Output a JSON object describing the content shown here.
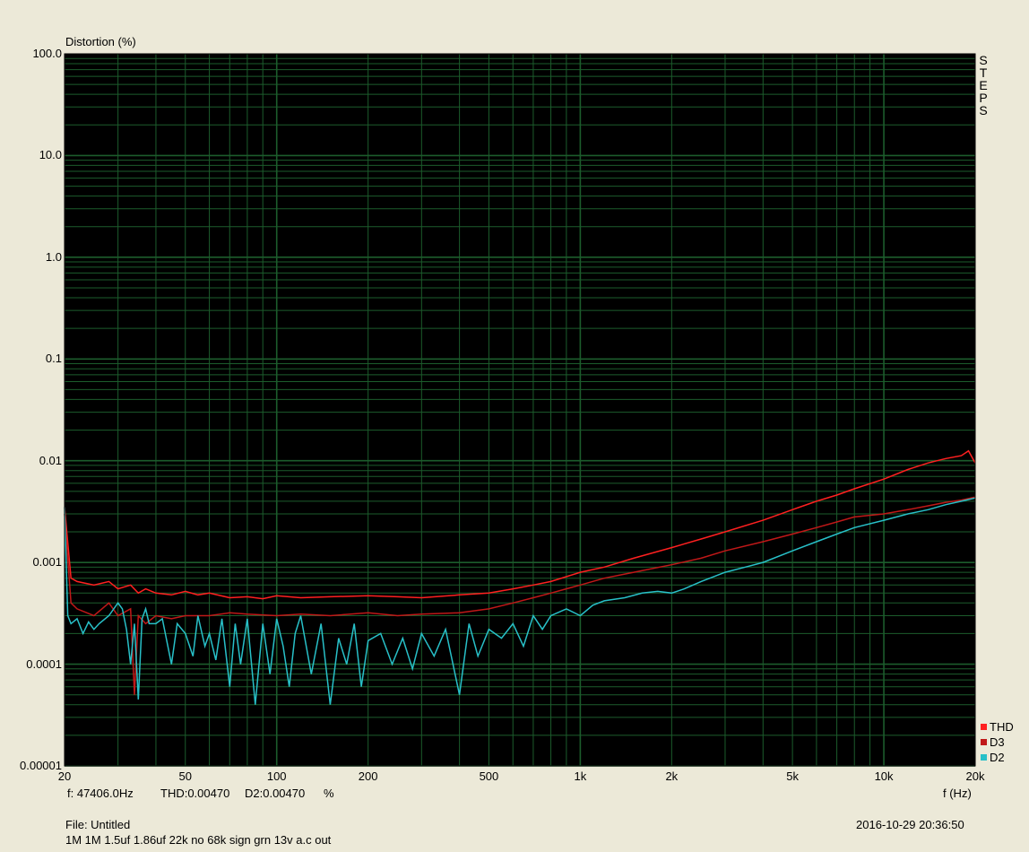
{
  "header": {
    "y_title": "Distortion (%)",
    "x_title": "f (Hz)",
    "steps_label": [
      "S",
      "T",
      "E",
      "P",
      "S"
    ]
  },
  "status": {
    "cursor_freq": "f: 47406.0Hz",
    "thd": "THD:0.00470",
    "d2": "D2:0.00470",
    "unit": "%"
  },
  "footer": {
    "file": "File: Untitled",
    "description": "1M 1M 1.5uf 1.86uf 22k no 68k sign grn 13v a.c out",
    "timestamp": "2016-10-29 20:36:50"
  },
  "colors": {
    "background": "#ece9d8",
    "plot_bg": "#000000",
    "grid": "#1c5c2c",
    "thd": "#ff2020",
    "d3": "#c01818",
    "d2": "#28c0c8"
  },
  "chart_data": {
    "type": "line",
    "x_scale": "log",
    "y_scale": "log",
    "xlim": [
      20,
      20000
    ],
    "ylim": [
      1e-05,
      100
    ],
    "x_ticks": [
      {
        "v": 20,
        "label": "20"
      },
      {
        "v": 50,
        "label": "50"
      },
      {
        "v": 100,
        "label": "100"
      },
      {
        "v": 200,
        "label": "200"
      },
      {
        "v": 500,
        "label": "500"
      },
      {
        "v": 1000,
        "label": "1k"
      },
      {
        "v": 2000,
        "label": "2k"
      },
      {
        "v": 5000,
        "label": "5k"
      },
      {
        "v": 10000,
        "label": "10k"
      },
      {
        "v": 20000,
        "label": "20k"
      }
    ],
    "y_ticks": [
      {
        "v": 100,
        "label": "100.0"
      },
      {
        "v": 10,
        "label": "10.0"
      },
      {
        "v": 1,
        "label": "1.0"
      },
      {
        "v": 0.1,
        "label": "0.1"
      },
      {
        "v": 0.01,
        "label": "0.01"
      },
      {
        "v": 0.001,
        "label": "0.001"
      },
      {
        "v": 0.0001,
        "label": "0.0001"
      },
      {
        "v": 1e-05,
        "label": "0.00001"
      }
    ],
    "legend_position": "bottom-right",
    "series": [
      {
        "name": "THD",
        "color": "#ff2020",
        "x": [
          20,
          21,
          22,
          25,
          28,
          30,
          33,
          35,
          37,
          40,
          45,
          50,
          55,
          60,
          70,
          80,
          90,
          100,
          120,
          150,
          200,
          250,
          300,
          400,
          500,
          600,
          700,
          800,
          1000,
          1200,
          1500,
          2000,
          2500,
          3000,
          4000,
          5000,
          6000,
          7000,
          8000,
          10000,
          12000,
          14000,
          16000,
          18000,
          19000,
          20000
        ],
        "y": [
          0.0035,
          0.0007,
          0.00065,
          0.0006,
          0.00065,
          0.00055,
          0.0006,
          0.0005,
          0.00055,
          0.0005,
          0.00048,
          0.00052,
          0.00048,
          0.0005,
          0.00045,
          0.00046,
          0.00044,
          0.00047,
          0.00045,
          0.00046,
          0.00047,
          0.00046,
          0.00045,
          0.00048,
          0.0005,
          0.00055,
          0.0006,
          0.00065,
          0.0008,
          0.0009,
          0.0011,
          0.0014,
          0.0017,
          0.002,
          0.0026,
          0.0033,
          0.004,
          0.0046,
          0.0053,
          0.0066,
          0.0082,
          0.0095,
          0.0105,
          0.0112,
          0.0125,
          0.0095
        ]
      },
      {
        "name": "D3",
        "color": "#c01818",
        "x": [
          20,
          21,
          22,
          25,
          28,
          30,
          33,
          34,
          35,
          37,
          40,
          45,
          50,
          60,
          70,
          80,
          100,
          120,
          150,
          200,
          250,
          300,
          400,
          500,
          600,
          700,
          800,
          1000,
          1200,
          1500,
          2000,
          2500,
          3000,
          4000,
          5000,
          6000,
          7000,
          8000,
          10000,
          12000,
          14000,
          16000,
          18000,
          20000
        ],
        "y": [
          0.003,
          0.0004,
          0.00035,
          0.0003,
          0.0004,
          0.0003,
          0.00035,
          5e-05,
          0.0003,
          0.00025,
          0.0003,
          0.00028,
          0.0003,
          0.0003,
          0.00032,
          0.00031,
          0.0003,
          0.00031,
          0.0003,
          0.00032,
          0.0003,
          0.00031,
          0.00032,
          0.00035,
          0.0004,
          0.00045,
          0.0005,
          0.0006,
          0.0007,
          0.0008,
          0.00095,
          0.0011,
          0.0013,
          0.0016,
          0.0019,
          0.0022,
          0.0025,
          0.0028,
          0.003,
          0.0033,
          0.0036,
          0.0039,
          0.0041,
          0.0044
        ]
      },
      {
        "name": "D2",
        "color": "#28c0c8",
        "x": [
          20,
          20.5,
          21,
          22,
          23,
          24,
          25,
          26,
          28,
          30,
          31,
          32,
          33,
          34,
          35,
          36,
          37,
          38,
          40,
          42,
          45,
          47,
          50,
          53,
          55,
          58,
          60,
          63,
          66,
          70,
          73,
          76,
          80,
          85,
          90,
          95,
          100,
          105,
          110,
          115,
          120,
          130,
          140,
          150,
          160,
          170,
          180,
          190,
          200,
          220,
          240,
          260,
          280,
          300,
          330,
          360,
          400,
          430,
          460,
          500,
          550,
          600,
          650,
          700,
          750,
          800,
          900,
          1000,
          1100,
          1200,
          1400,
          1600,
          1800,
          2000,
          2200,
          2500,
          3000,
          3500,
          4000,
          5000,
          6000,
          7000,
          8000,
          10000,
          12000,
          14000,
          16000,
          18000,
          20000
        ],
        "y": [
          0.0035,
          0.0003,
          0.00025,
          0.00028,
          0.0002,
          0.00026,
          0.00022,
          0.00025,
          0.0003,
          0.0004,
          0.00035,
          0.00022,
          0.0001,
          0.00025,
          4.5e-05,
          0.00028,
          0.00035,
          0.00025,
          0.00025,
          0.00028,
          0.0001,
          0.00025,
          0.0002,
          0.00012,
          0.0003,
          0.00015,
          0.0002,
          0.00011,
          0.00028,
          6e-05,
          0.00025,
          0.0001,
          0.00028,
          4e-05,
          0.00025,
          8e-05,
          0.00028,
          0.00015,
          6e-05,
          0.0002,
          0.0003,
          8e-05,
          0.00025,
          4e-05,
          0.00018,
          0.0001,
          0.00025,
          6e-05,
          0.00017,
          0.0002,
          0.0001,
          0.00018,
          9e-05,
          0.0002,
          0.00012,
          0.00022,
          5e-05,
          0.00025,
          0.00012,
          0.00022,
          0.00018,
          0.00025,
          0.00015,
          0.0003,
          0.00022,
          0.0003,
          0.00035,
          0.0003,
          0.00038,
          0.00042,
          0.00045,
          0.0005,
          0.00052,
          0.0005,
          0.00055,
          0.00065,
          0.0008,
          0.0009,
          0.001,
          0.0013,
          0.0016,
          0.0019,
          0.0022,
          0.0026,
          0.003,
          0.0033,
          0.0037,
          0.004,
          0.0043
        ]
      }
    ]
  }
}
